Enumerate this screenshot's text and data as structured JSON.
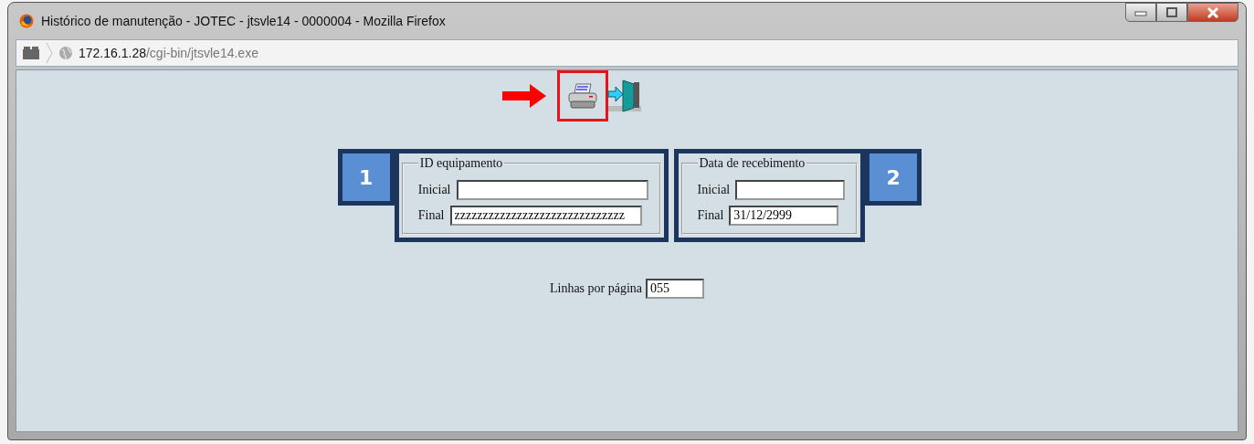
{
  "window": {
    "title": "Histórico de manutenção - JOTEC - jtsvle14 - 0000004 - Mozilla Firefox"
  },
  "address": {
    "host": "172.16.1.28",
    "path": "/cgi-bin/jtsvle14.exe"
  },
  "toolbar": {
    "print_highlighted": true
  },
  "groups": [
    {
      "badge": "1",
      "kind": "leftbadge",
      "legend": "ID equipamento",
      "fields": [
        {
          "label": "Inicial"
        },
        {
          "label": "Final",
          "value": "zzzzzzzzzzzzzzzzzzzzzzzzzzzzzz"
        }
      ]
    },
    {
      "badge": "2",
      "kind": "rightbadge",
      "legend": "Data de recebimento",
      "fields": [
        {
          "label": "Inicial"
        },
        {
          "label": "Final",
          "value": "31/12/2999"
        }
      ]
    }
  ],
  "lines_per_page": {
    "label": "Linhas por página",
    "value": "055"
  }
}
